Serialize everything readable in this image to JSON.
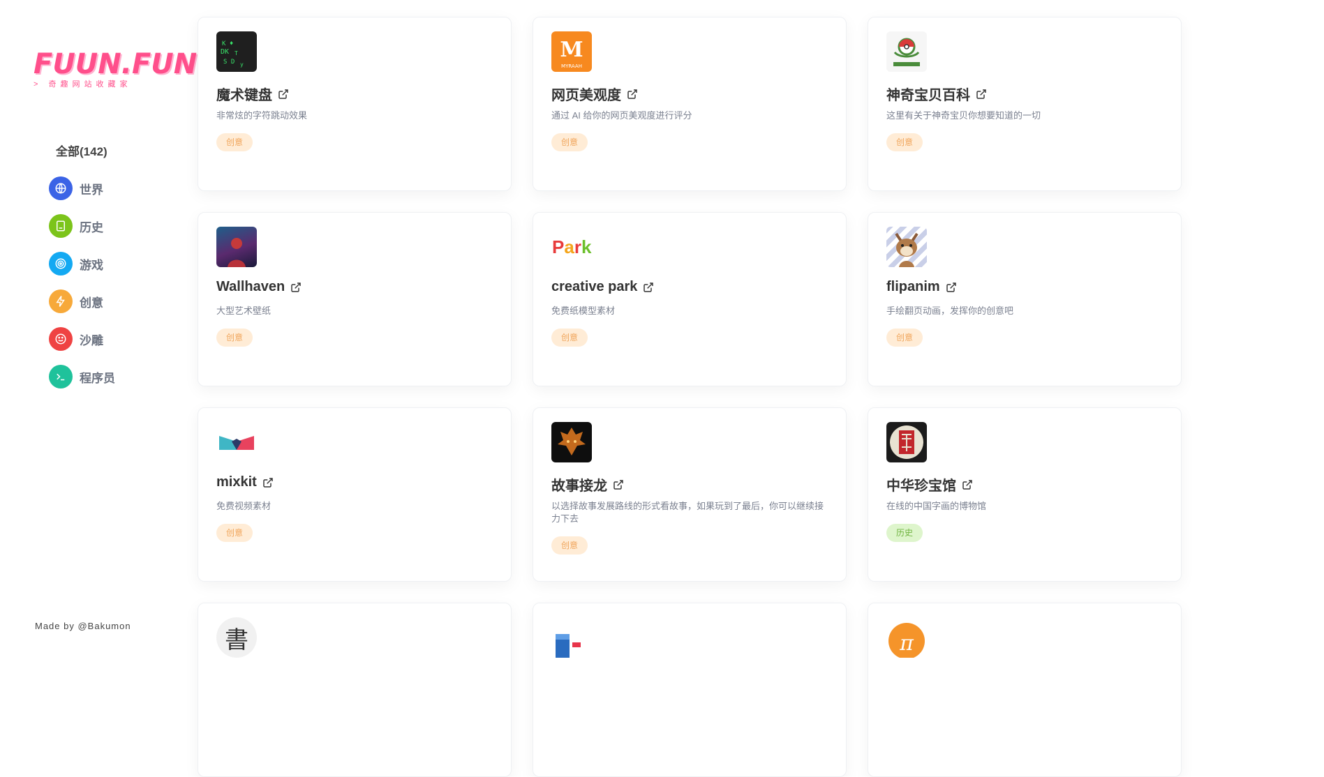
{
  "brand": {
    "logo_text": "FUUN.FUN",
    "tagline": "> 奇趣网站收藏家"
  },
  "nav": {
    "all_label": "全部(142)",
    "items": [
      {
        "label": "世界",
        "color": "#3b63e6",
        "icon": "globe-icon"
      },
      {
        "label": "历史",
        "color": "#7cc41b",
        "icon": "book-icon"
      },
      {
        "label": "游戏",
        "color": "#13a9f2",
        "icon": "target-icon"
      },
      {
        "label": "创意",
        "color": "#f7a93a",
        "icon": "bolt-icon"
      },
      {
        "label": "沙雕",
        "color": "#ef4343",
        "icon": "smile-icon"
      },
      {
        "label": "程序员",
        "color": "#1fc29b",
        "icon": "terminal-icon"
      }
    ]
  },
  "footer": {
    "made_by": "Made by @Bakumon"
  },
  "cards": [
    {
      "title": "魔术键盘",
      "desc": "非常炫的字符跳动效果",
      "tag": "创意",
      "icon": "magic-keyboard-logo"
    },
    {
      "title": "网页美观度",
      "desc": "通过 AI 给你的网页美观度进行评分",
      "tag": "创意",
      "icon": "myraah-logo"
    },
    {
      "title": "神奇宝贝百科",
      "desc": "这里有关于神奇宝贝你想要知道的一切",
      "tag": "创意",
      "icon": "pokeball-logo"
    },
    {
      "title": "Wallhaven",
      "desc": "大型艺术壁纸",
      "tag": "创意",
      "icon": "wallhaven-logo"
    },
    {
      "title": "creative park",
      "desc": "免费纸模型素材",
      "tag": "创意",
      "icon": "creative-park-logo"
    },
    {
      "title": "flipanim",
      "desc": "手绘翻页动画，发挥你的创意吧",
      "tag": "创意",
      "icon": "flipanim-logo"
    },
    {
      "title": "mixkit",
      "desc": "免费视频素材",
      "tag": "创意",
      "icon": "mixkit-logo"
    },
    {
      "title": "故事接龙",
      "desc": "以选择故事发展路线的形式看故事，如果玩到了最后，你可以继续接力下去",
      "tag": "创意",
      "icon": "dragon-logo"
    },
    {
      "title": "中华珍宝馆",
      "desc": "在线的中国字画的博物馆",
      "tag": "历史",
      "icon": "treasure-museum-logo"
    }
  ],
  "partial_cards": [
    {
      "icon": "shu-logo",
      "glyph": "書"
    },
    {
      "icon": "mailbox-logo"
    },
    {
      "icon": "pi-logo",
      "glyph": "π"
    }
  ]
}
